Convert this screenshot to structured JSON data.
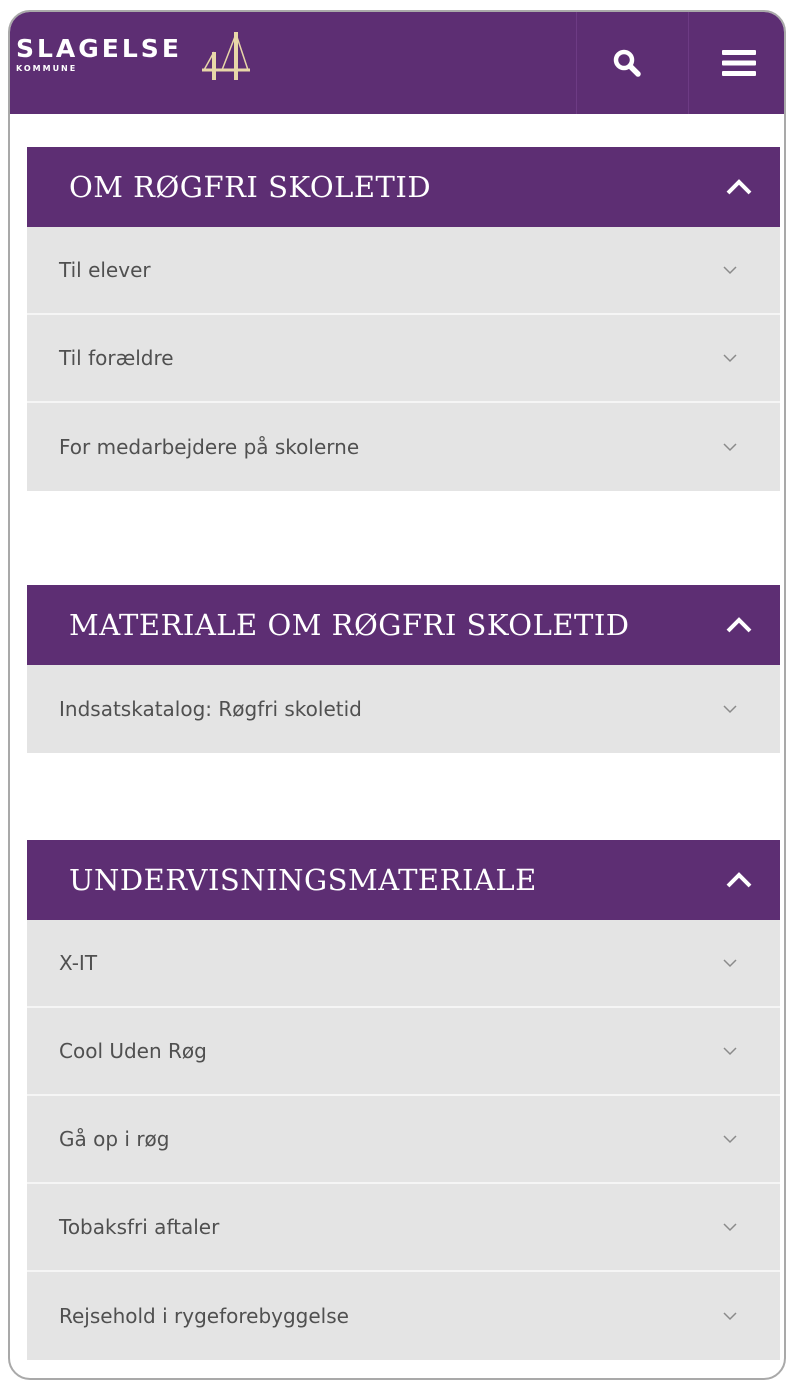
{
  "header": {
    "logo_main": "SLAGELSE",
    "logo_sub": "KOMMUNE",
    "brand_color": "#5d2e73",
    "search_icon": "search-icon",
    "menu_icon": "hamburger-menu-icon"
  },
  "sections": [
    {
      "title": "OM RØGFRI SKOLETID",
      "items": [
        "Til elever",
        "Til forældre",
        "For medarbejdere på skolerne"
      ]
    },
    {
      "title": "MATERIALE OM RØGFRI SKOLETID",
      "items": [
        "Indsatskatalog: Røgfri skoletid"
      ]
    },
    {
      "title": "UNDERVISNINGSMATERIALE",
      "items": [
        "X-IT",
        "Cool Uden Røg",
        "Gå op i røg",
        "Tobaksfri aftaler",
        "Rejsehold i rygeforebyggelse"
      ]
    }
  ]
}
